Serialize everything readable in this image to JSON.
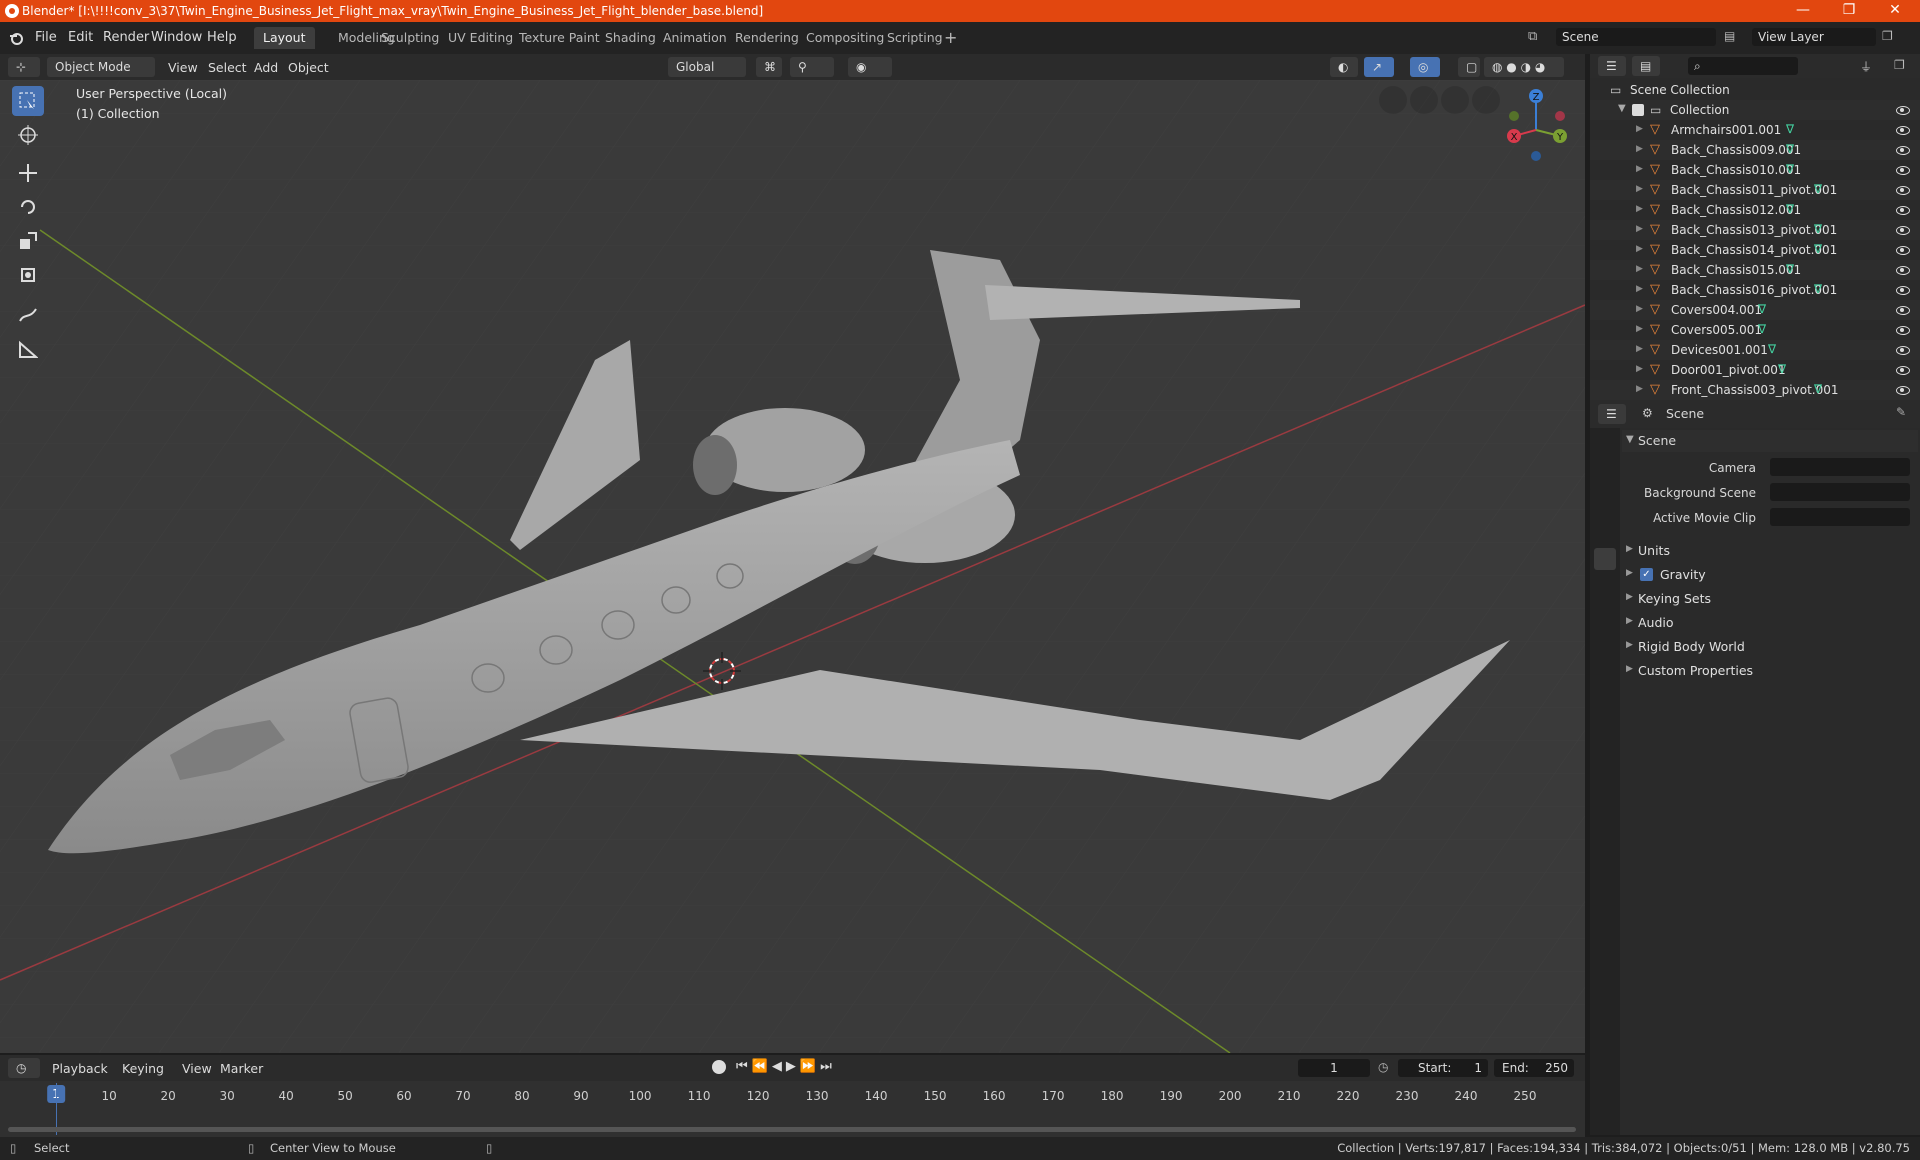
{
  "window": {
    "title": "Blender* [I:\\!!!!conv_3\\37\\Twin_Engine_Business_Jet_Flight_max_vray\\Twin_Engine_Business_Jet_Flight_blender_base.blend]",
    "minimize": "—",
    "restore": "❐",
    "close": "✕"
  },
  "menu": [
    "File",
    "Edit",
    "Render",
    "Window",
    "Help"
  ],
  "workspaces": [
    "Layout",
    "Modeling",
    "Sculpting",
    "UV Editing",
    "Texture Paint",
    "Shading",
    "Animation",
    "Rendering",
    "Compositing",
    "Scripting"
  ],
  "active_workspace": "Layout",
  "scene_field": "Scene",
  "view_layer_field": "View Layer",
  "viewport_header": {
    "mode": "Object Mode",
    "menus": [
      "View",
      "Select",
      "Add",
      "Object"
    ],
    "orientation": "Global"
  },
  "viewport": {
    "perspective_label": "User Perspective (Local)",
    "collection_label": "(1) Collection",
    "axis_labels": {
      "x": "X",
      "y": "Y",
      "z": "Z"
    }
  },
  "outliner": {
    "root": "Scene Collection",
    "collection": "Collection",
    "items": [
      "Armchairs001.001",
      "Back_Chassis009.001",
      "Back_Chassis010.001",
      "Back_Chassis011_pivot.001",
      "Back_Chassis012.001",
      "Back_Chassis013_pivot.001",
      "Back_Chassis014_pivot.001",
      "Back_Chassis015.001",
      "Back_Chassis016_pivot.001",
      "Covers004.001",
      "Covers005.001",
      "Devices001.001",
      "Door001_pivot.001",
      "Front_Chassis003_pivot.001"
    ]
  },
  "properties": {
    "header": "Scene",
    "panel": "Scene",
    "fields": [
      {
        "label": "Camera",
        "value": ""
      },
      {
        "label": "Background Scene",
        "value": ""
      },
      {
        "label": "Active Movie Clip",
        "value": ""
      }
    ],
    "sections": [
      "Units",
      "Gravity",
      "Keying Sets",
      "Audio",
      "Rigid Body World",
      "Custom Properties"
    ],
    "gravity_checked": true
  },
  "timeline": {
    "menus": [
      "Playback",
      "Keying",
      "View",
      "Marker"
    ],
    "current_frame": "1",
    "start_label": "Start:",
    "start": "1",
    "end_label": "End:",
    "end": "250",
    "ticks": [
      "1",
      "10",
      "20",
      "30",
      "40",
      "50",
      "60",
      "70",
      "80",
      "90",
      "100",
      "110",
      "120",
      "130",
      "140",
      "150",
      "160",
      "170",
      "180",
      "190",
      "200",
      "210",
      "220",
      "230",
      "240",
      "250"
    ]
  },
  "status": {
    "left_action": "Select",
    "middle_action": "Center View to Mouse",
    "stats": "Collection | Verts:197,817 | Faces:194,334 | Tris:384,072 | Objects:0/51 | Mem: 128.0 MB | v2.80.75"
  },
  "colors": {
    "title_bar": "#e2470f",
    "active_tool": "#4772b3",
    "x_axis": "#d83a4c",
    "y_axis": "#7ba032",
    "z_axis": "#3b7fd6",
    "frame_marker": "#4772b3",
    "mesh_icon": "#e8843a",
    "data_icon": "#44d1a0"
  }
}
